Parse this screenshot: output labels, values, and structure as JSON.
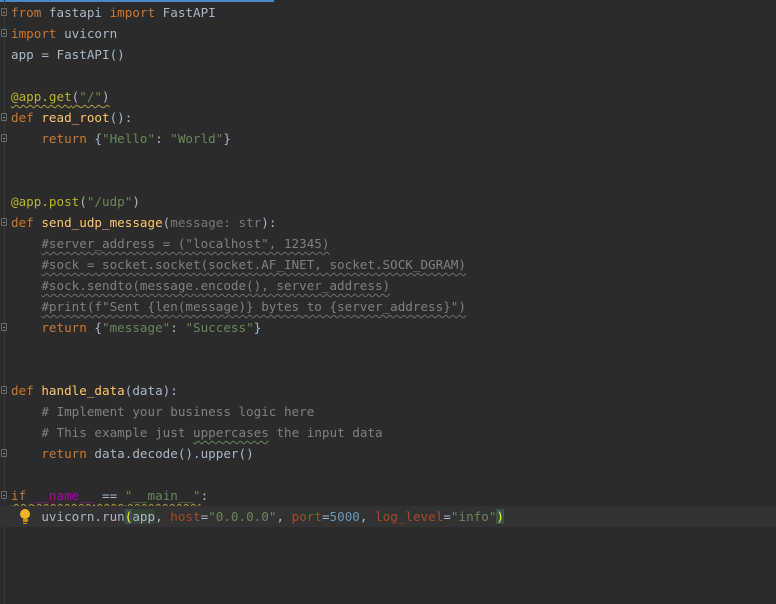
{
  "editor": {
    "lines": [
      [
        {
          "t": "from",
          "c": "kw"
        },
        {
          "t": " fastapi "
        },
        {
          "t": "import",
          "c": "kw"
        },
        {
          "t": " FastAPI"
        }
      ],
      [
        {
          "t": "import",
          "c": "kw"
        },
        {
          "t": " uvicorn"
        }
      ],
      [
        {
          "t": "app = FastAPI()"
        }
      ],
      [],
      [
        {
          "t": "@app.get",
          "c": "dec sq-yellow"
        },
        {
          "t": "(",
          "c": "sq-yellow"
        },
        {
          "t": "\"/\"",
          "c": "str sq-yellow"
        },
        {
          "t": ")",
          "c": "sq-yellow"
        }
      ],
      [
        {
          "t": "def",
          "c": "kw"
        },
        {
          "t": " "
        },
        {
          "t": "read_root",
          "c": "fn"
        },
        {
          "t": "():"
        }
      ],
      [
        {
          "t": "    "
        },
        {
          "t": "return",
          "c": "kw"
        },
        {
          "t": " {"
        },
        {
          "t": "\"Hello\"",
          "c": "str"
        },
        {
          "t": ": "
        },
        {
          "t": "\"World\"",
          "c": "str"
        },
        {
          "t": "}"
        }
      ],
      [],
      [],
      [
        {
          "t": "@app.post",
          "c": "dec"
        },
        {
          "t": "("
        },
        {
          "t": "\"/udp\"",
          "c": "str"
        },
        {
          "t": ")"
        }
      ],
      [
        {
          "t": "def",
          "c": "kw"
        },
        {
          "t": " "
        },
        {
          "t": "send_udp_message",
          "c": "fn"
        },
        {
          "t": "("
        },
        {
          "t": "message: str",
          "c": "hint"
        },
        {
          "t": "):"
        }
      ],
      [
        {
          "t": "    "
        },
        {
          "t": "#server_address = (\"localhost\", 12345)",
          "c": "cmt sq-grey"
        }
      ],
      [
        {
          "t": "    "
        },
        {
          "t": "#sock = socket.socket(socket.AF_INET, socket.SOCK_DGRAM)",
          "c": "cmt sq-grey"
        }
      ],
      [
        {
          "t": "    "
        },
        {
          "t": "#sock.sendto(message.encode(), server_address)",
          "c": "cmt sq-grey"
        }
      ],
      [
        {
          "t": "    "
        },
        {
          "t": "#print(f\"Sent {len(message)} bytes to {server_address}\")",
          "c": "cmt sq-grey"
        }
      ],
      [
        {
          "t": "    "
        },
        {
          "t": "return",
          "c": "kw"
        },
        {
          "t": " {"
        },
        {
          "t": "\"message\"",
          "c": "str"
        },
        {
          "t": ": "
        },
        {
          "t": "\"Success\"",
          "c": "str"
        },
        {
          "t": "}"
        }
      ],
      [],
      [],
      [
        {
          "t": "def",
          "c": "kw"
        },
        {
          "t": " "
        },
        {
          "t": "handle_data",
          "c": "fn"
        },
        {
          "t": "(data):"
        }
      ],
      [
        {
          "t": "    "
        },
        {
          "t": "# Implement your business logic here",
          "c": "cmt"
        }
      ],
      [
        {
          "t": "    "
        },
        {
          "t": "# This example just ",
          "c": "cmt"
        },
        {
          "t": "uppercases",
          "c": "cmt sq-green"
        },
        {
          "t": " the input data",
          "c": "cmt"
        }
      ],
      [
        {
          "t": "    "
        },
        {
          "t": "return",
          "c": "kw"
        },
        {
          "t": " data.decode().upper()"
        }
      ],
      [],
      [
        {
          "t": "if",
          "c": "kw sq-yellow"
        },
        {
          "t": " ",
          "c": "sq-yellow"
        },
        {
          "t": "__name__",
          "c": "dunder sq-yellow"
        },
        {
          "t": " == ",
          "c": "sq-yellow"
        },
        {
          "t": "\"__main__\"",
          "c": "str sq-yellow"
        },
        {
          "t": ":"
        }
      ],
      [
        {
          "t": "    uvicorn.run"
        },
        {
          "t": "(",
          "c": "brace-match"
        },
        {
          "t": "app",
          "c": "ident-hl"
        },
        {
          "t": ", "
        },
        {
          "t": "host",
          "c": "param"
        },
        {
          "t": "="
        },
        {
          "t": "\"0.0.0.0\"",
          "c": "str"
        },
        {
          "t": ", "
        },
        {
          "t": "port",
          "c": "param"
        },
        {
          "t": "="
        },
        {
          "t": "5000",
          "c": "num"
        },
        {
          "t": ", "
        },
        {
          "t": "log_level",
          "c": "param"
        },
        {
          "t": "="
        },
        {
          "t": "\"info\"",
          "c": "str"
        },
        {
          "t": ")",
          "c": "brace-match"
        }
      ]
    ],
    "fold_markers": [
      0,
      1,
      5,
      6,
      10,
      15,
      18,
      21,
      23
    ],
    "current_line": 24,
    "intention_icon": "lightbulb-icon",
    "colors": {
      "background": "#2b2b2b",
      "keyword": "#cc7832",
      "function": "#ffc66d",
      "decorator": "#bbb529",
      "string": "#6a8759",
      "number": "#6897bb",
      "comment": "#808080",
      "named_param": "#aa4926",
      "dunder": "#b200b2",
      "default_text": "#a9b7c6",
      "lightbulb": "#f0b429"
    }
  }
}
